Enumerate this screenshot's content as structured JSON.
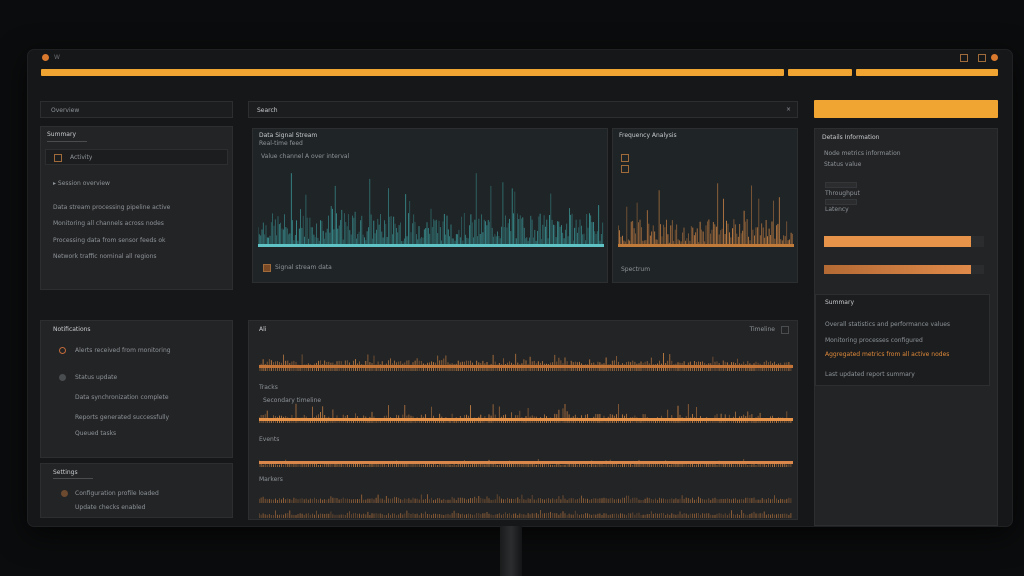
{
  "window": {
    "title_bar_label": "W",
    "controls": [
      "minimize-icon",
      "maximize-icon",
      "close-icon"
    ]
  },
  "colors": {
    "accent": "#f0a431",
    "orange": "#e8934a",
    "teal": "#3fa6a8",
    "panel": "#232425",
    "background": "#161718"
  },
  "left": {
    "section1_title": "Overview",
    "section1_sub": "Summary",
    "item1_label": "Activity",
    "lines": [
      "▸ Session overview",
      "Data stream processing pipeline active",
      "Monitoring all channels across nodes",
      "Processing data from sensor feeds ok",
      "Network traffic nominal all regions"
    ],
    "section2_title": "Notifications",
    "notif_lines": [
      "Alerts received from monitoring",
      "Status update",
      "Data synchronization complete",
      "Reports generated successfully",
      "Queued tasks"
    ],
    "section3_title": "Settings",
    "settings_lines": [
      "Configuration profile loaded",
      "Update checks enabled"
    ]
  },
  "center": {
    "search_label": "Search",
    "chart1": {
      "title": "Data Signal Stream",
      "subtitle": "Real-time feed",
      "legend": "Value channel A over interval",
      "footer": "Signal stream data"
    },
    "chart2": {
      "title": "Frequency Analysis",
      "footer": "Spectrum"
    },
    "timeline": {
      "title": "Ali",
      "right_label": "Timeline",
      "row_labels": [
        "Tracks",
        "Secondary timeline",
        "Events",
        "Markers"
      ]
    }
  },
  "right": {
    "header_title": "Details Information",
    "lines": [
      "Node metrics information",
      "Status value",
      "Throughput",
      "Latency"
    ],
    "progress": [
      0.92,
      0.92
    ],
    "sub_title": "Summary",
    "sub_lines": [
      "Overall statistics and performance values",
      "Monitoring processes configured",
      "Aggregated metrics from all active nodes",
      "Last updated report summary"
    ]
  }
}
